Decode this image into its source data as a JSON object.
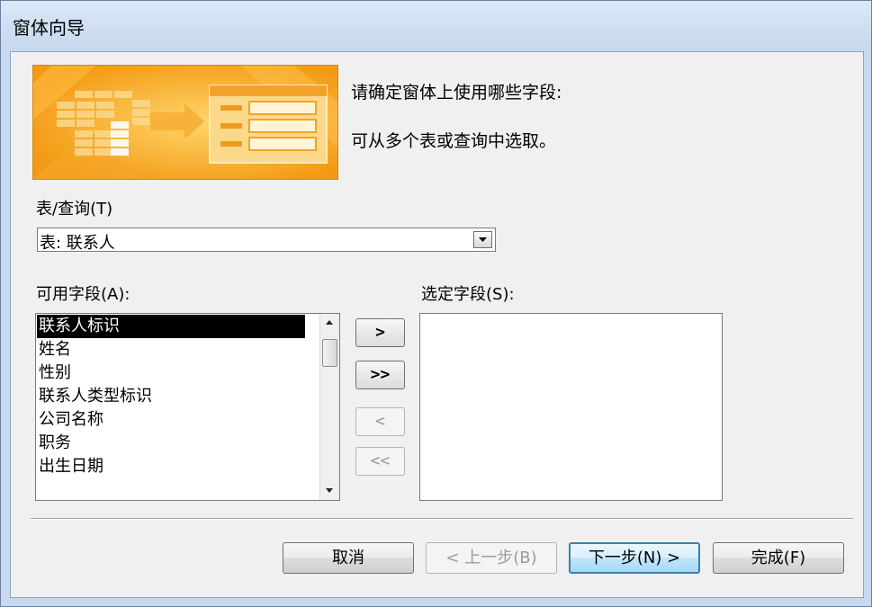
{
  "window": {
    "title": "窗体向导"
  },
  "prompt": {
    "line1": "请确定窗体上使用哪些字段:",
    "line2": "可从多个表或查询中选取。"
  },
  "table_query": {
    "label": "表/查询(T)",
    "value": "表: 联系人"
  },
  "available_fields": {
    "label": "可用字段(A):",
    "items": [
      "联系人标识",
      "姓名",
      "性别",
      "联系人类型标识",
      "公司名称",
      "职务",
      "出生日期"
    ],
    "selected_index": 0
  },
  "selected_fields": {
    "label": "选定字段(S):",
    "items": []
  },
  "move_buttons": {
    "add_one": ">",
    "add_all": ">>",
    "remove_one": "<",
    "remove_all": "<<"
  },
  "buttons": {
    "cancel": "取消",
    "back": "< 上一步(B)",
    "next": "下一步(N) >",
    "finish": "完成(F)"
  },
  "colors": {
    "banner": "#f6a51f",
    "selection": "#000000",
    "default_button_border": "#3c7fb1"
  }
}
